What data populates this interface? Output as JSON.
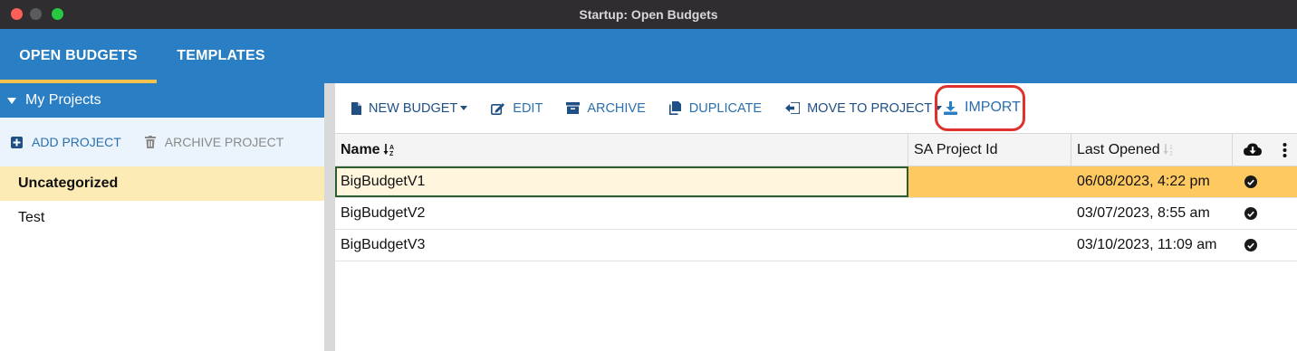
{
  "window": {
    "title": "Startup: Open Budgets"
  },
  "topnav": {
    "tabs": [
      {
        "label": "OPEN BUDGETS"
      },
      {
        "label": "TEMPLATES"
      }
    ]
  },
  "sidebar": {
    "section_title": "My Projects",
    "add_project_label": "ADD PROJECT",
    "archive_project_label": "ARCHIVE PROJECT",
    "projects": [
      {
        "label": "Uncategorized",
        "selected": true
      },
      {
        "label": "Test",
        "selected": false
      }
    ]
  },
  "toolbar": {
    "new_budget_label": "NEW BUDGET",
    "edit_label": "EDIT",
    "archive_label": "ARCHIVE",
    "duplicate_label": "DUPLICATE",
    "move_label": "MOVE TO PROJECT",
    "import_label": "IMPORT"
  },
  "table": {
    "columns": {
      "name": "Name",
      "sa_project_id": "SA Project Id",
      "last_opened": "Last Opened"
    },
    "rows": [
      {
        "name": "BigBudgetV1",
        "sa_project_id": "",
        "last_opened": "06/08/2023, 4:22 pm",
        "synced": true,
        "selected": true
      },
      {
        "name": "BigBudgetV2",
        "sa_project_id": "",
        "last_opened": "03/07/2023, 8:55 am",
        "synced": true,
        "selected": false
      },
      {
        "name": "BigBudgetV3",
        "sa_project_id": "",
        "last_opened": "03/10/2023, 11:09 am",
        "synced": true,
        "selected": false
      }
    ]
  },
  "colors": {
    "accent_blue": "#2a7fc4",
    "active_tab_underline": "#f3c24c",
    "selected_row": "#fdc960",
    "import_highlight": "#e0322c"
  },
  "icons": [
    "file-icon",
    "edit-icon",
    "archive-box-icon",
    "duplicate-icon",
    "move-icon",
    "import-icon",
    "plus-square-icon",
    "trash-icon",
    "cloud-download-icon",
    "more-vertical-icon",
    "check-circle-icon"
  ]
}
